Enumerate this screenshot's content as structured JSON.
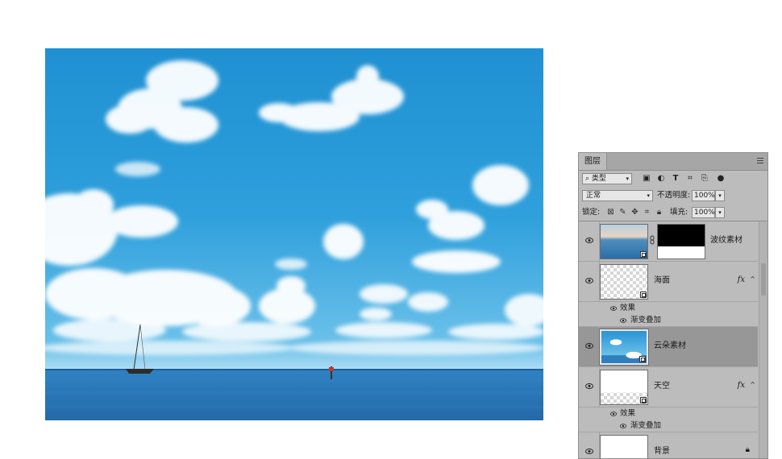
{
  "panel": {
    "tab_label": "图层",
    "filter": {
      "label": "类型"
    },
    "blend_mode": "正常",
    "opacity": {
      "label": "不透明度:",
      "value": "100%"
    },
    "lock": {
      "label": "锁定:"
    },
    "fill": {
      "label": "填充:",
      "value": "100%"
    },
    "layers": [
      {
        "name": "波纹素材",
        "has_mask": true,
        "thumb": "sea-photo"
      },
      {
        "name": "海面",
        "has_fx": true,
        "fx_label": "fx",
        "thumb": "transparent",
        "effects_label": "效果",
        "effect": "渐变叠加"
      },
      {
        "name": "云朵素材",
        "selected": true,
        "thumb": "sky-photo"
      },
      {
        "name": "天空",
        "has_fx": true,
        "fx_label": "fx",
        "thumb": "transparent",
        "effects_label": "效果",
        "effect": "渐变叠加"
      },
      {
        "name": "背景",
        "locked": true,
        "thumb": "white"
      }
    ]
  },
  "colors": {
    "panel_bg": "#bcbcbc",
    "selected_row": "#979797",
    "sky_top": "#1f90d2",
    "sea": "#2c7fc0"
  },
  "icons": [
    "search-icon",
    "image-filter-icon",
    "adjustment-filter-icon",
    "type-filter-icon",
    "shape-filter-icon",
    "smart-object-filter-icon",
    "eye-icon",
    "chain-link-icon",
    "lock-icon",
    "panel-menu-icon"
  ]
}
